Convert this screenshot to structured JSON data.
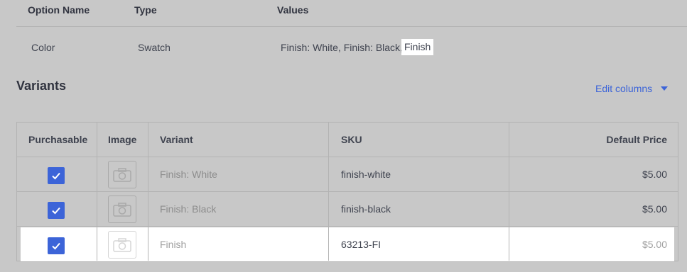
{
  "options": {
    "headers": {
      "name": "Option Name",
      "type": "Type",
      "values": "Values"
    },
    "row": {
      "name": "Color",
      "type": "Swatch",
      "values_text": "Finish: White, Finish: Black,",
      "editing_value": "Finish"
    }
  },
  "variants": {
    "title": "Variants",
    "edit_columns_label": "Edit columns",
    "columns": [
      "Purchasable",
      "Image",
      "Variant",
      "SKU",
      "Default Price"
    ],
    "rows": [
      {
        "purchasable": true,
        "variant": "Finish: White",
        "sku": "finish-white",
        "price": "$5.00"
      },
      {
        "purchasable": true,
        "variant": "Finish: Black",
        "sku": "finish-black",
        "price": "$5.00"
      },
      {
        "purchasable": true,
        "variant": "Finish",
        "sku": "63213-FI",
        "price": "$5.00"
      }
    ]
  },
  "colors": {
    "accent": "#3c64d8",
    "overlay": "#c8c8c8",
    "highlight": "#ffffff"
  }
}
